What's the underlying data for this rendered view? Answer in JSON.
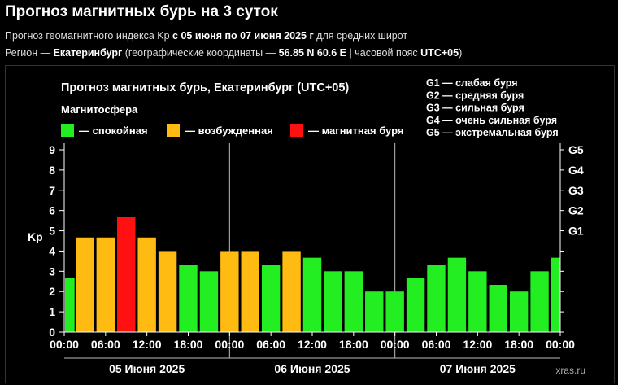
{
  "page": {
    "title": "Прогноз магнитных бурь на 3 суток",
    "sub1": {
      "prefix": "Прогноз геомагнитного индекса Kp ",
      "period": "с 05 июня по 07 июня 2025 г",
      "suffix": " для средних широт"
    },
    "sub2": {
      "prefix": "Регион — ",
      "city": "Екатеринбург",
      "mid": " (географические координаты — ",
      "coords": "56.85 N 60.6 E",
      "mid2": " | часовой пояс ",
      "tz": "UTC+05",
      "suffix": ")"
    },
    "watermark": "xras.ru"
  },
  "colors": {
    "background": "#000000",
    "calm": "#22ee22",
    "excited": "#ffbb11",
    "storm": "#ff1111"
  },
  "chart_data": {
    "type": "bar",
    "title": "Прогноз магнитных бурь, Екатеринбург (UTC+05)",
    "ylabel": "Kp",
    "ylim": [
      0,
      9
    ],
    "y_ticks": [
      0,
      1,
      2,
      3,
      4,
      5,
      6,
      7,
      8,
      9
    ],
    "right_axis": [
      {
        "label": "G1",
        "kp": 5
      },
      {
        "label": "G2",
        "kp": 6
      },
      {
        "label": "G3",
        "kp": 7
      },
      {
        "label": "G4",
        "kp": 8
      },
      {
        "label": "G5",
        "kp": 9
      }
    ],
    "legend": {
      "heading": "Магнитосфера",
      "items": [
        {
          "label": "— спокойная",
          "color": "#22ee22"
        },
        {
          "label": "— возбужденная",
          "color": "#ffbb11"
        },
        {
          "label": "— магнитная буря",
          "color": "#ff1111"
        }
      ]
    },
    "storm_levels": [
      "G1 — слабая буря",
      "G2 — средняя буря",
      "G3 — сильная буря",
      "G4 — очень сильная буря",
      "G5 — экстремальная буря"
    ],
    "x_tick_labels": [
      "00:00",
      "06:00",
      "12:00",
      "18:00",
      "00:00",
      "06:00",
      "12:00",
      "18:00",
      "00:00",
      "06:00",
      "12:00",
      "18:00",
      "00:00"
    ],
    "days": [
      "05 Июня 2025",
      "06 Июня 2025",
      "07 Июня 2025"
    ],
    "intervals_per_day": 8,
    "values": [
      2.67,
      4.67,
      4.67,
      5.67,
      4.67,
      4.0,
      3.33,
      3.0,
      4.0,
      4.0,
      3.33,
      4.0,
      3.67,
      3.0,
      3.0,
      2.0,
      2.0,
      2.67,
      3.33,
      3.67,
      3.0,
      2.33,
      2.0,
      3.0,
      3.67
    ],
    "status": [
      "calm",
      "excited",
      "excited",
      "storm",
      "excited",
      "excited",
      "calm",
      "calm",
      "excited",
      "excited",
      "calm",
      "excited",
      "calm",
      "calm",
      "calm",
      "calm",
      "calm",
      "calm",
      "calm",
      "calm",
      "calm",
      "calm",
      "calm",
      "calm",
      "calm"
    ]
  }
}
